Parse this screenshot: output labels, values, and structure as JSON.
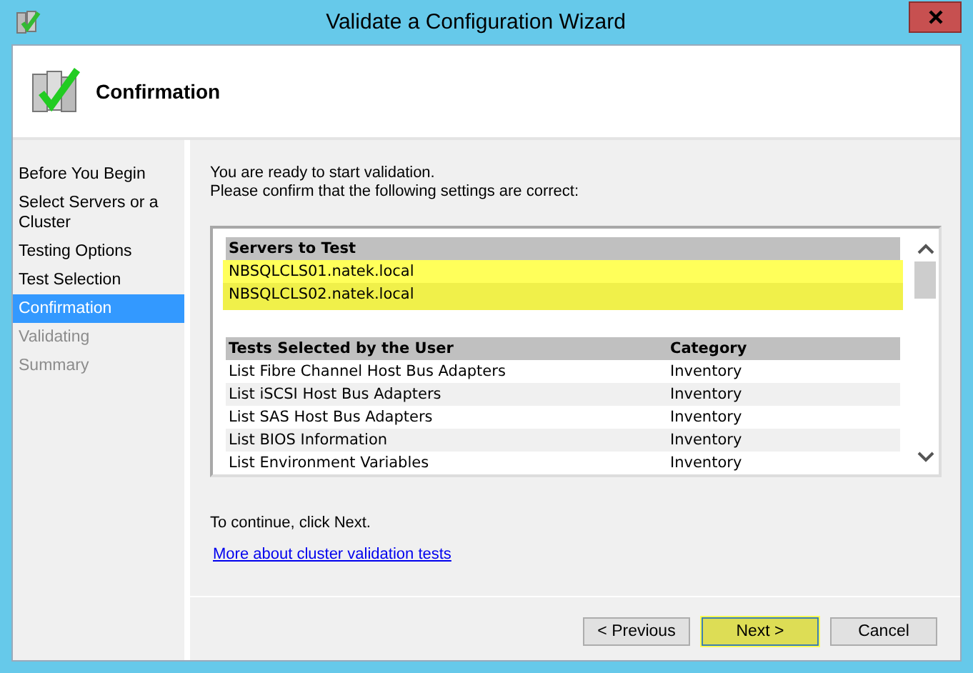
{
  "window": {
    "title": "Validate a Configuration Wizard"
  },
  "header": {
    "title": "Confirmation"
  },
  "steps": [
    {
      "label": "Before You Begin",
      "selected": false,
      "disabled": false
    },
    {
      "label": "Select Servers or a Cluster",
      "selected": false,
      "disabled": false
    },
    {
      "label": "Testing Options",
      "selected": false,
      "disabled": false
    },
    {
      "label": "Test Selection",
      "selected": false,
      "disabled": false
    },
    {
      "label": "Confirmation",
      "selected": true,
      "disabled": false
    },
    {
      "label": "Validating",
      "selected": false,
      "disabled": true
    },
    {
      "label": "Summary",
      "selected": false,
      "disabled": true
    }
  ],
  "intro": [
    "You are ready to start validation.",
    "Please confirm that the following settings are correct:"
  ],
  "servers": {
    "heading": "Servers to Test",
    "rows": [
      {
        "name": "NBSQLCLS01.natek.local",
        "highlighted": true
      },
      {
        "name": "NBSQLCLS02.natek.local",
        "highlighted": true
      }
    ]
  },
  "tests": {
    "columns": [
      "Tests Selected by the User",
      "Category"
    ],
    "rows": [
      [
        "List Fibre Channel Host Bus Adapters",
        "Inventory"
      ],
      [
        "List iSCSI Host Bus Adapters",
        "Inventory"
      ],
      [
        "List SAS Host Bus Adapters",
        "Inventory"
      ],
      [
        "List BIOS Information",
        "Inventory"
      ],
      [
        "List Environment Variables",
        "Inventory"
      ]
    ]
  },
  "continue_text": "To continue, click Next.",
  "link": "More about cluster validation tests",
  "buttons": [
    {
      "label": "< Previous",
      "highlighted": false
    },
    {
      "label": "Next >",
      "highlighted": true
    },
    {
      "label": "Cancel",
      "highlighted": false
    }
  ]
}
